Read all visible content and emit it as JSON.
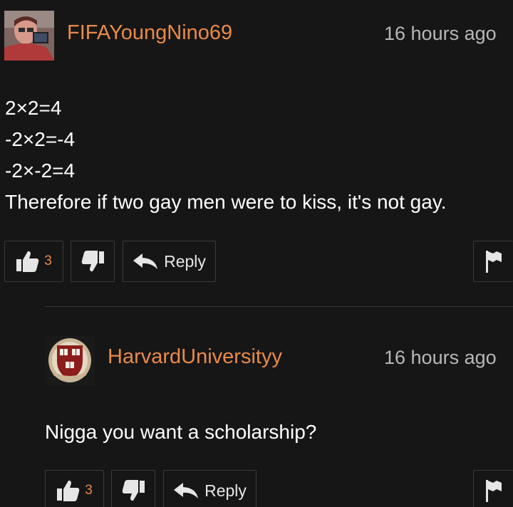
{
  "comments": [
    {
      "username": "FIFAYoungNino69",
      "timestamp": "16 hours ago",
      "body_lines": [
        "2×2=4",
        "-2×2=-4",
        "-2×-2=4",
        "Therefore if two gay men were to kiss, it's not gay."
      ],
      "upvotes": "3",
      "reply_label": "Reply",
      "avatar_icon": "user-photo-avatar"
    },
    {
      "username": "HarvardUniversityy",
      "timestamp": "16 hours ago",
      "body_lines": [
        "Nigga you want a scholarship?"
      ],
      "upvotes": "3",
      "reply_label": "Reply",
      "avatar_icon": "harvard-shield-avatar"
    }
  ],
  "icons": {
    "thumbs_up": "thumbs-up-icon",
    "thumbs_down": "thumbs-down-icon",
    "reply": "reply-arrow-icon",
    "flag": "flag-icon"
  },
  "colors": {
    "background": "#161616",
    "username": "#e98a4a",
    "count": "#e98a4a",
    "text": "#ffffff",
    "timestamp": "#b8b8b8",
    "border": "#3b3b3b"
  }
}
